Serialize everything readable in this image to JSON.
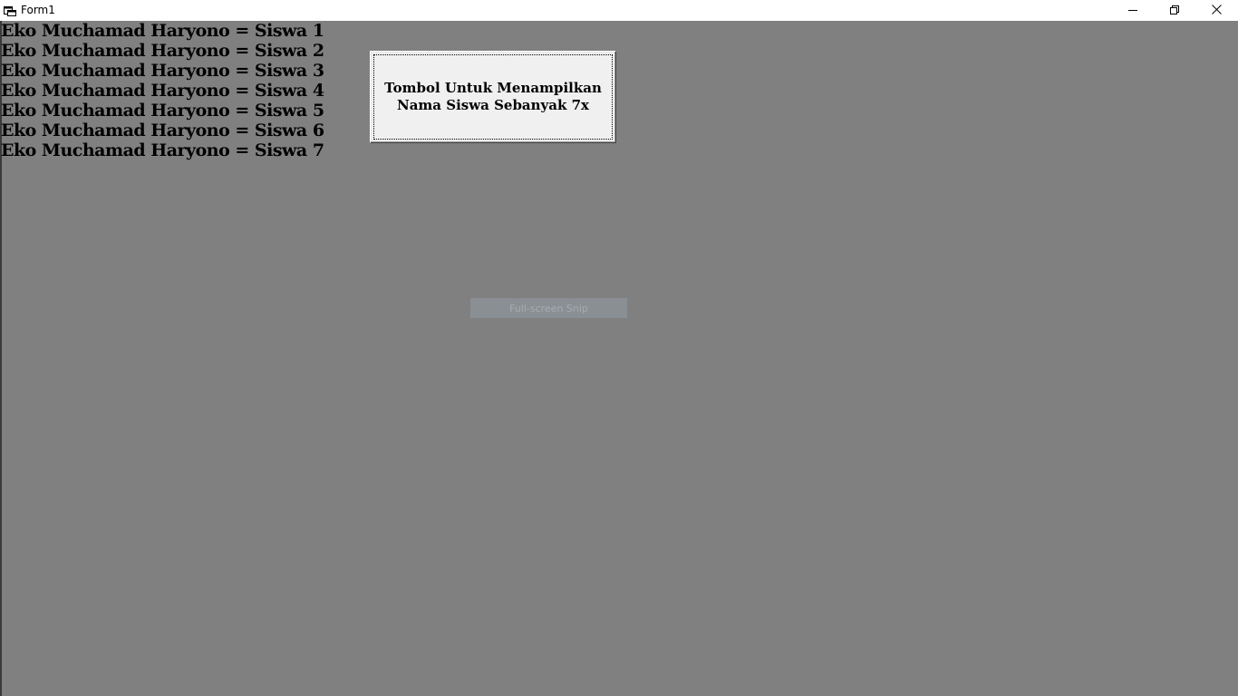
{
  "window": {
    "title": "Form1",
    "icon": "form-window-icon",
    "controls": {
      "minimize": "minimize-icon",
      "restore": "restore-icon",
      "close": "close-icon"
    }
  },
  "output": {
    "lines": [
      "Eko Muchamad Haryono = Siswa 1",
      "Eko Muchamad Haryono = Siswa 2",
      "Eko Muchamad Haryono = Siswa 3",
      "Eko Muchamad Haryono = Siswa 4",
      "Eko Muchamad Haryono = Siswa 5",
      "Eko Muchamad Haryono = Siswa 6",
      "Eko Muchamad Haryono = Siswa 7"
    ]
  },
  "button": {
    "label": "Tombol Untuk Menampilkan\nNama Siswa Sebanyak 7x"
  },
  "overlay": {
    "snip_label": "Full-screen Snip"
  },
  "colors": {
    "form_background": "#808080",
    "button_face": "#f0f0f0",
    "titlebar": "#ffffff"
  }
}
